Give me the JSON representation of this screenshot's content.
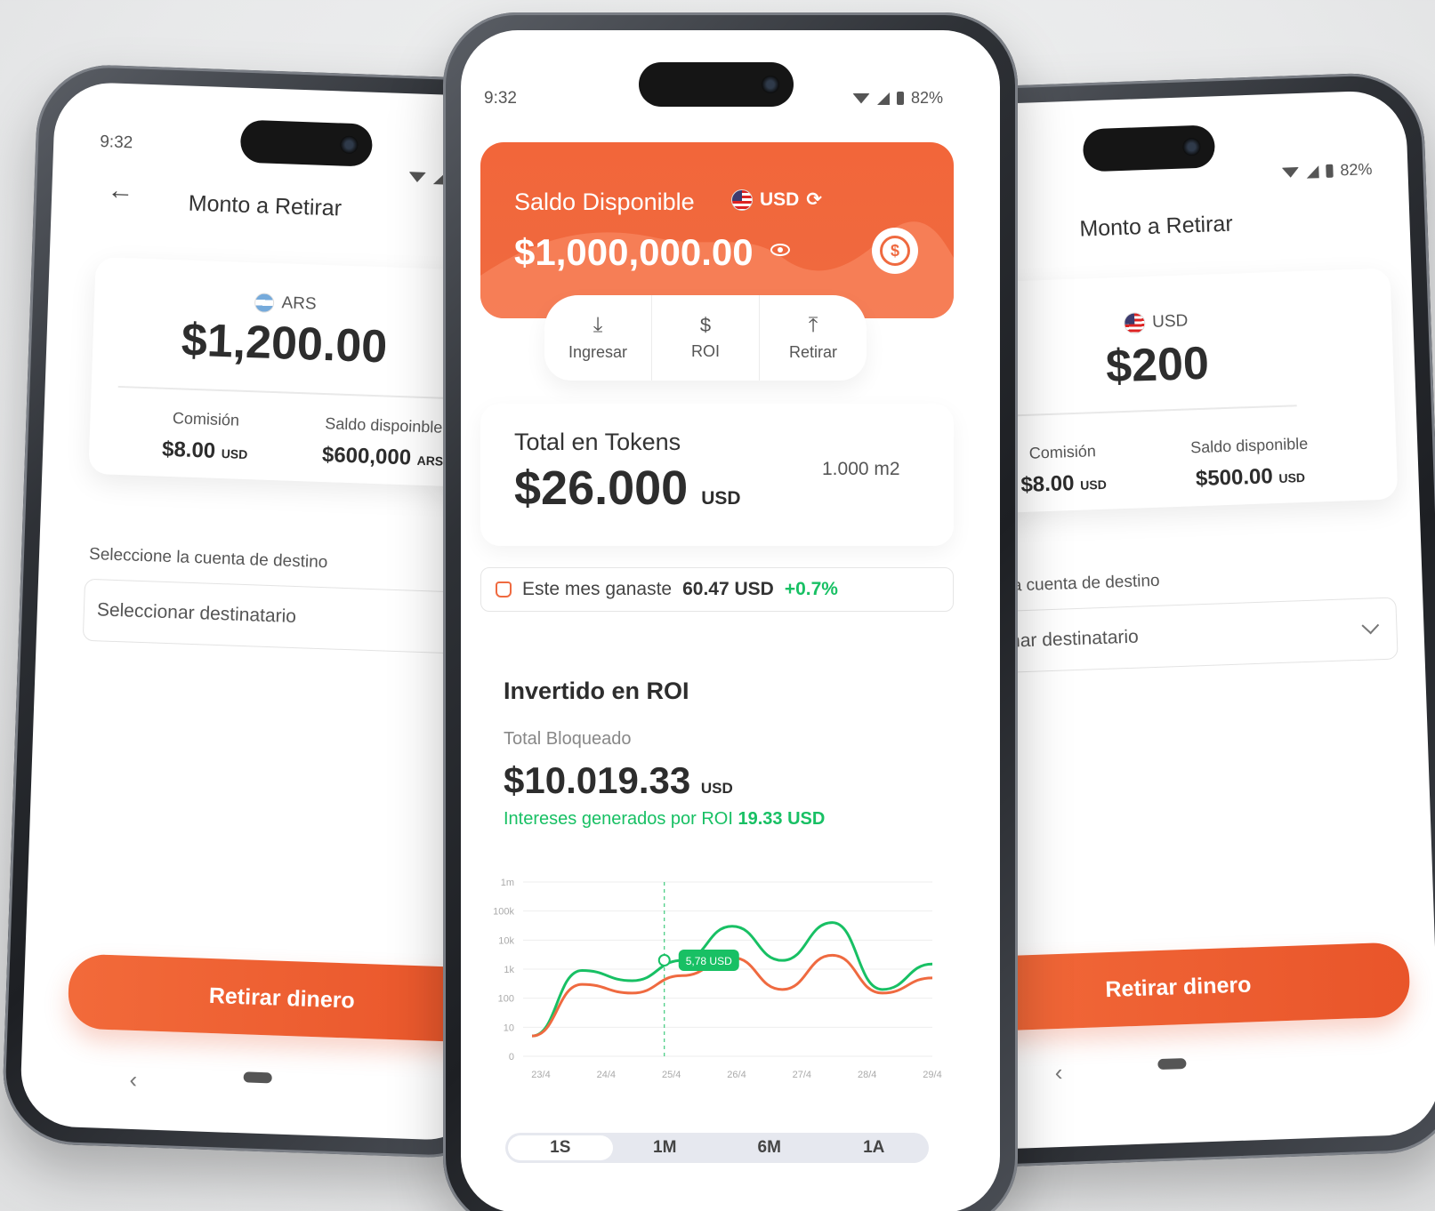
{
  "status": {
    "time": "9:32",
    "battery": "82%"
  },
  "left_screen": {
    "title": "Monto a Retirar",
    "currency": "ARS",
    "amount": "$1,200.00",
    "commission_label": "Comisión",
    "commission_value": "$8.00",
    "commission_unit": "USD",
    "balance_label": "Saldo dispoinble",
    "balance_value": "$600,000",
    "balance_unit": "ARS",
    "destination_label": "Seleccione la cuenta de destino",
    "destination_placeholder": "Seleccionar destinatario",
    "button": "Retirar dinero"
  },
  "right_screen": {
    "title": "Monto a Retirar",
    "currency": "USD",
    "amount": "$200",
    "commission_label": "Comisión",
    "commission_value": "$8.00",
    "commission_unit": "USD",
    "balance_label": "Saldo disponible",
    "balance_value": "$500.00",
    "balance_unit": "USD",
    "destination_label": "leccione la cuenta de destino",
    "destination_placeholder": "eleccionar destinatario",
    "button": "Retirar dinero"
  },
  "center_screen": {
    "balance_title": "Saldo Disponible",
    "balance_currency": "USD",
    "balance_amount": "$1,000,000.00",
    "actions": [
      "Ingresar",
      "ROI",
      "Retirar"
    ],
    "tokens_title": "Total en Tokens",
    "tokens_amount": "$26.000",
    "tokens_unit": "USD",
    "tokens_area": "1.000 m2",
    "earn_text": "Este mes ganaste",
    "earn_amount": "60.47 USD",
    "earn_pct": "+0.7%",
    "roi_title": "Invertido en ROI",
    "roi_sub": "Total Bloqueado",
    "roi_amount": "$10.019.33",
    "roi_unit": "USD",
    "roi_interest_label": "Intereses generados por ROI",
    "roi_interest_value": "19.33 USD",
    "periods": [
      "1S",
      "1M",
      "6M",
      "1A"
    ],
    "active_period": "1S"
  },
  "colors": {
    "brand": "#ef6a40",
    "green": "#18c064",
    "orange_line": "#ef6a40"
  },
  "chart_data": {
    "type": "line",
    "y_scale": "log",
    "y_ticks": [
      "1m",
      "100k",
      "10k",
      "1k",
      "100",
      "10",
      "0"
    ],
    "x": [
      "23/4",
      "24/4",
      "25/4",
      "26/4",
      "27/4",
      "28/4",
      "29/4"
    ],
    "tooltip": "5,78 USD",
    "series": [
      {
        "color": "#18c064",
        "values": [
          5,
          900,
          400,
          2000,
          30000,
          2000,
          40000,
          200,
          1500
        ]
      },
      {
        "color": "#ef6a40",
        "values": [
          5,
          300,
          150,
          600,
          2500,
          200,
          3000,
          150,
          500
        ]
      }
    ]
  }
}
